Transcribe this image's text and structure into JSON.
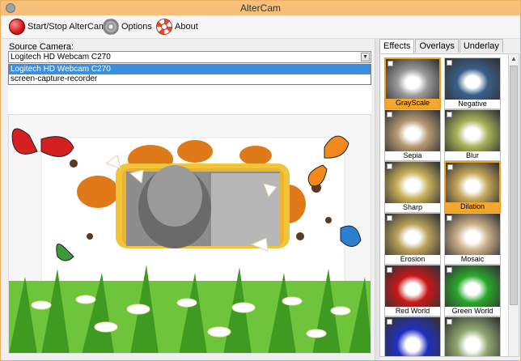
{
  "window": {
    "title": "AlterCam"
  },
  "toolbar": {
    "start_stop_label": "Start/Stop AlterCam",
    "options_label": "Options",
    "about_label": "About"
  },
  "source": {
    "label": "Source Camera:",
    "selected": "Logitech HD Webcam C270",
    "options": [
      "Logitech HD Webcam C270",
      "screen-capture-recorder"
    ]
  },
  "tabs": [
    {
      "label": "Effects",
      "active": true
    },
    {
      "label": "Overlays",
      "active": false
    },
    {
      "label": "Underlay",
      "active": false
    }
  ],
  "effects": [
    {
      "name": "GrayScale",
      "selected": true,
      "color": "#9a9a9a"
    },
    {
      "name": "Negative",
      "selected": false,
      "color": "#3a5f8a"
    },
    {
      "name": "Sepia",
      "selected": false,
      "color": "#b59a73"
    },
    {
      "name": "Blur",
      "selected": false,
      "color": "#a8b35a"
    },
    {
      "name": "Sharp",
      "selected": false,
      "color": "#c9b25a"
    },
    {
      "name": "Dilation",
      "selected": true,
      "color": "#c7a85c"
    },
    {
      "name": "Erosion",
      "selected": false,
      "color": "#b9a25a"
    },
    {
      "name": "Mosaic",
      "selected": false,
      "color": "#cbb08a"
    },
    {
      "name": "Red World",
      "selected": false,
      "color": "#c81818"
    },
    {
      "name": "Green World",
      "selected": false,
      "color": "#2aa82a"
    },
    {
      "name": "",
      "selected": false,
      "color": "#2030c0"
    },
    {
      "name": "",
      "selected": false,
      "color": "#8fa870"
    }
  ]
}
